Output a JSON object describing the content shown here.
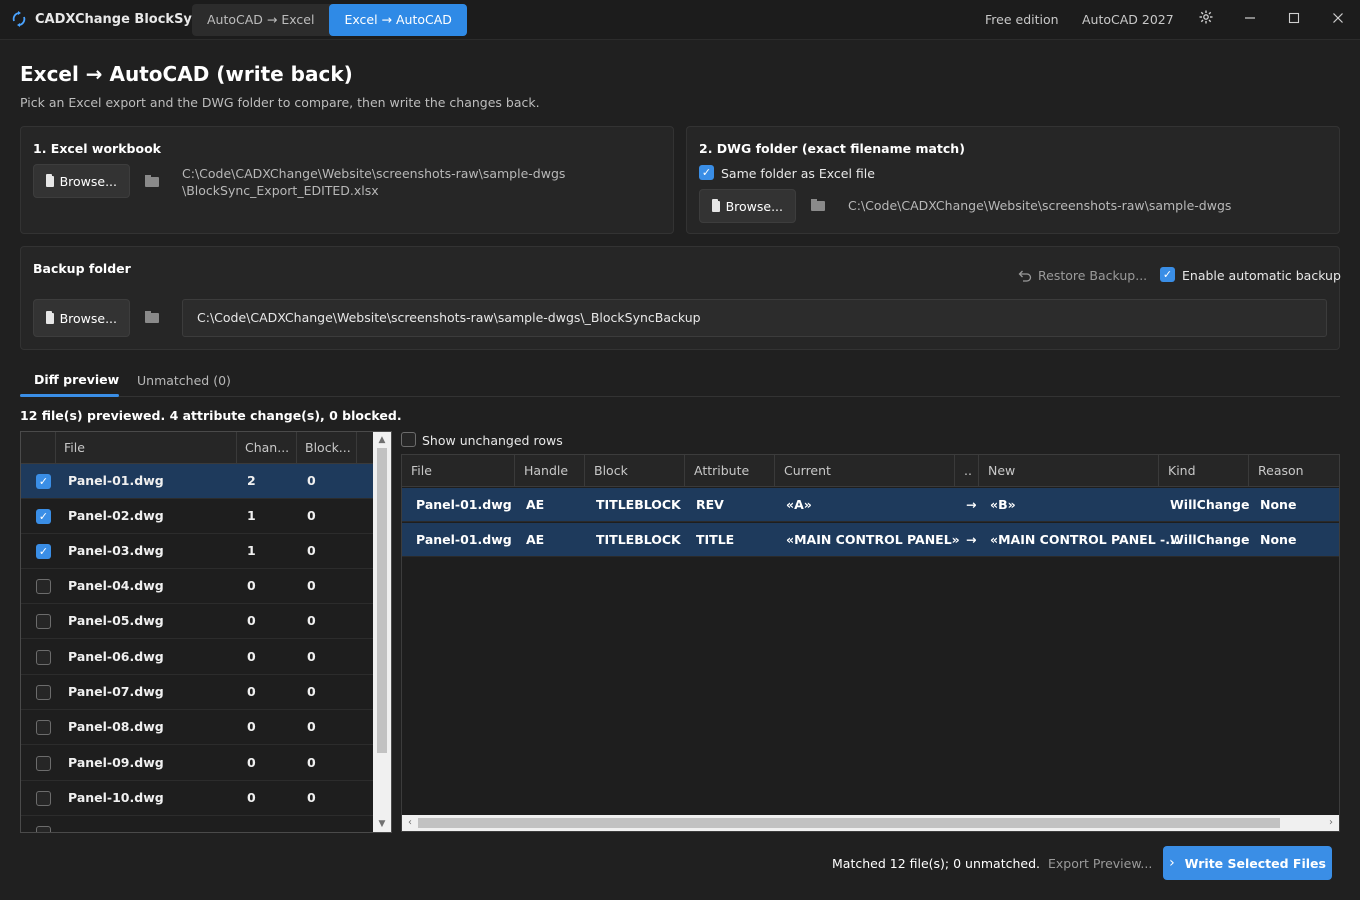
{
  "app": {
    "title": "CADXChange BlockSync"
  },
  "modes": [
    {
      "label": "AutoCAD → Excel",
      "active": false
    },
    {
      "label": "Excel → AutoCAD",
      "active": true
    }
  ],
  "titlebar": {
    "edition": "Free edition",
    "autocad_version": "AutoCAD 2027"
  },
  "page": {
    "title": "Excel → AutoCAD (write back)",
    "subtitle": "Pick an Excel export and the DWG folder to compare, then write the changes back."
  },
  "excel_card": {
    "title": "1. Excel workbook",
    "browse_label": "Browse...",
    "path_line1": "C:\\Code\\CADXChange\\Website\\screenshots-raw\\sample-dwgs",
    "path_line2": "\\BlockSync_Export_EDITED.xlsx"
  },
  "dwg_card": {
    "title": "2. DWG folder (exact filename match)",
    "same_folder_label": "Same folder as Excel file",
    "same_folder_checked": true,
    "browse_label": "Browse...",
    "path": "C:\\Code\\CADXChange\\Website\\screenshots-raw\\sample-dwgs"
  },
  "backup_card": {
    "title": "Backup folder",
    "restore_label": "Restore Backup...",
    "auto_backup_label": "Enable automatic backup",
    "auto_backup_checked": true,
    "browse_label": "Browse...",
    "path": "C:\\Code\\CADXChange\\Website\\screenshots-raw\\sample-dwgs\\_BlockSyncBackup"
  },
  "tabs": [
    {
      "label": "Diff preview",
      "active": true
    },
    {
      "label": "Unmatched (0)",
      "active": false
    }
  ],
  "summary": "12 file(s) previewed. 4 attribute change(s), 0 blocked.",
  "show_unchanged_label": "Show unchanged rows",
  "file_list": {
    "columns": [
      "File",
      "Chan...",
      "Block..."
    ],
    "rows": [
      {
        "file": "Panel-01.dwg",
        "changes": "2",
        "blocked": "0",
        "checked": true
      },
      {
        "file": "Panel-02.dwg",
        "changes": "1",
        "blocked": "0",
        "checked": true
      },
      {
        "file": "Panel-03.dwg",
        "changes": "1",
        "blocked": "0",
        "checked": true
      },
      {
        "file": "Panel-04.dwg",
        "changes": "0",
        "blocked": "0",
        "checked": false
      },
      {
        "file": "Panel-05.dwg",
        "changes": "0",
        "blocked": "0",
        "checked": false
      },
      {
        "file": "Panel-06.dwg",
        "changes": "0",
        "blocked": "0",
        "checked": false
      },
      {
        "file": "Panel-07.dwg",
        "changes": "0",
        "blocked": "0",
        "checked": false
      },
      {
        "file": "Panel-08.dwg",
        "changes": "0",
        "blocked": "0",
        "checked": false
      },
      {
        "file": "Panel-09.dwg",
        "changes": "0",
        "blocked": "0",
        "checked": false
      },
      {
        "file": "Panel-10.dwg",
        "changes": "0",
        "blocked": "0",
        "checked": false
      }
    ]
  },
  "diff_grid": {
    "columns": [
      "File",
      "Handle",
      "Block",
      "Attribute",
      "Current",
      "..",
      "New",
      "Kind",
      "Reason"
    ],
    "rows": [
      {
        "file": "Panel-01.dwg",
        "handle": "AE",
        "block": "TITLEBLOCK",
        "attribute": "REV",
        "current": "«A»",
        "arrow": "→",
        "new": "«B»",
        "kind": "WillChange",
        "reason": "None"
      },
      {
        "file": "Panel-01.dwg",
        "handle": "AE",
        "block": "TITLEBLOCK",
        "attribute": "TITLE",
        "current": "«MAIN CONTROL PANEL»",
        "arrow": "→",
        "new": "«MAIN CONTROL PANEL -...",
        "kind": "WillChange",
        "reason": "None"
      }
    ]
  },
  "footer": {
    "status": "Matched 12 file(s); 0 unmatched.",
    "export_label": "Export Preview...",
    "write_label": "Write Selected Files"
  }
}
